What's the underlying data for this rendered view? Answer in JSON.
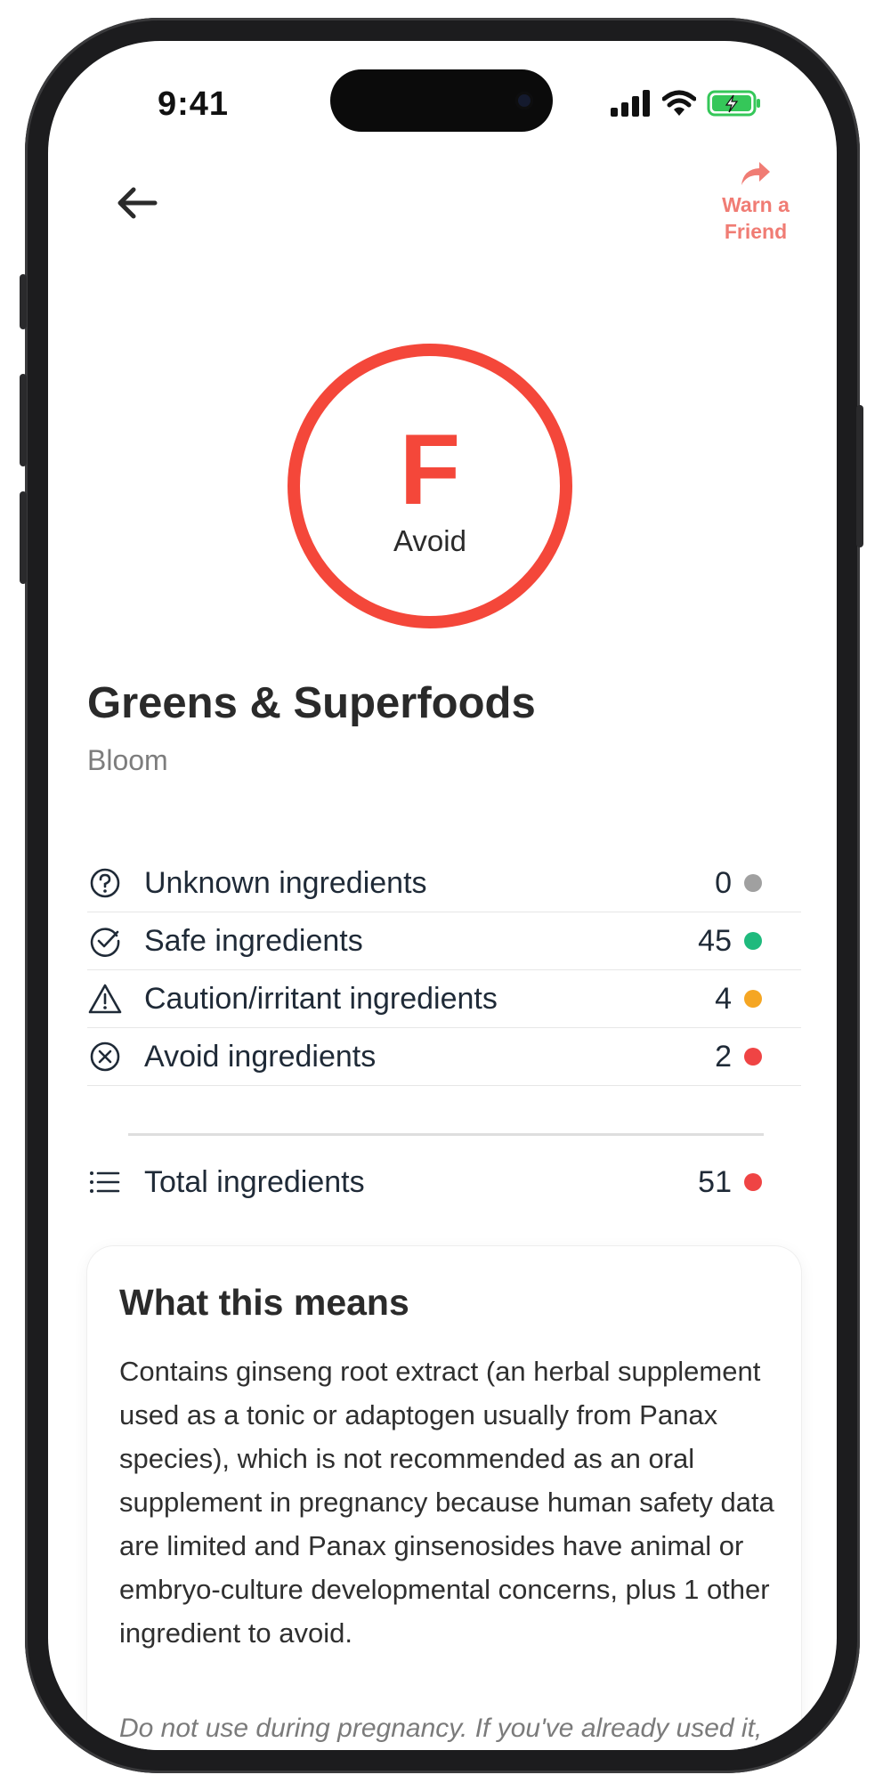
{
  "status_bar": {
    "time": "9:41"
  },
  "header": {
    "warn_label_line1": "Warn a",
    "warn_label_line2": "Friend"
  },
  "grade": {
    "letter": "F",
    "label": "Avoid",
    "color": "#f4473a"
  },
  "product": {
    "name": "Greens & Superfoods",
    "brand": "Bloom"
  },
  "stats": {
    "unknown": {
      "label": "Unknown ingredients",
      "count": "0",
      "color": "#a0a0a0",
      "icon": "question-circle-icon"
    },
    "safe": {
      "label": "Safe ingredients",
      "count": "45",
      "color": "#1fba7d",
      "icon": "check-circle-icon"
    },
    "caution": {
      "label": "Caution/irritant ingredients",
      "count": "4",
      "color": "#f5a623",
      "icon": "warning-triangle-icon"
    },
    "avoid": {
      "label": "Avoid ingredients",
      "count": "2",
      "color": "#ef4444",
      "icon": "x-circle-icon"
    },
    "total": {
      "label": "Total ingredients",
      "count": "51",
      "color": "#ef4444",
      "icon": "list-icon"
    }
  },
  "card": {
    "title": "What this means",
    "body": "Contains ginseng root extract (an herbal supplement used as a tonic or adaptogen usually from Panax species), which is not recommended as an oral supplement in pregnancy because human safety data are limited and Panax ginsenosides have animal or embryo-culture developmental concerns, plus 1 other ingredient to avoid.",
    "note": "Do not use during pregnancy. If you've already used it, don't worry - we're all learning. If it was heavy usage, please contact your OBGYN or"
  }
}
